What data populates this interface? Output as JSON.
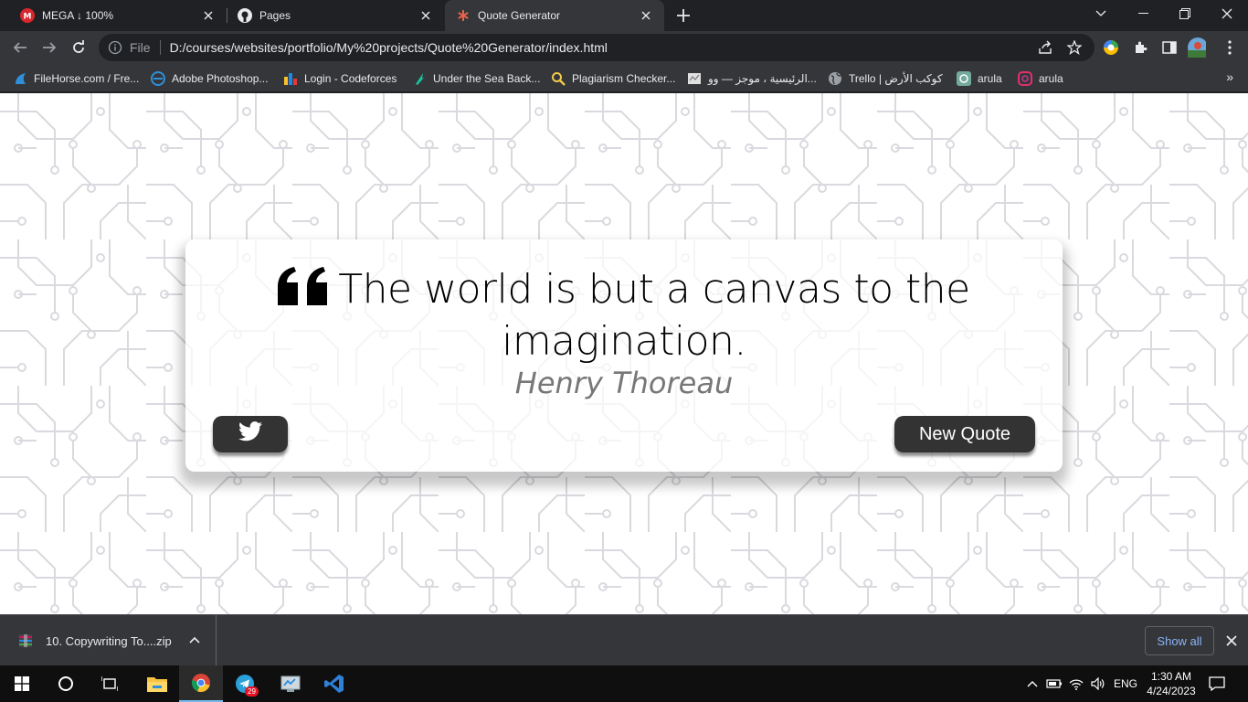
{
  "browser": {
    "tabs": [
      {
        "title": "MEGA ↓ 100%",
        "icon": "mega-icon"
      },
      {
        "title": "Pages",
        "icon": "github-icon"
      },
      {
        "title": "Quote Generator",
        "icon": "asterisk-icon",
        "active": true
      }
    ],
    "address": {
      "scheme_label": "File",
      "url": "D:/courses/websites/portfolio/My%20projects/Quote%20Generator/index.html"
    },
    "bookmarks": [
      {
        "label": "FileHorse.com / Fre...",
        "icon": "filehorse-icon"
      },
      {
        "label": "Adobe Photoshop...",
        "icon": "adobe-icon"
      },
      {
        "label": "Login - Codeforces",
        "icon": "codeforces-icon"
      },
      {
        "label": "Under the Sea Back...",
        "icon": "sea-icon"
      },
      {
        "label": "Plagiarism Checker...",
        "icon": "magnifier-icon"
      },
      {
        "label": "الرئيسية ، موجز — وو...",
        "icon": "page-icon"
      },
      {
        "label": "Trello | كوكب الأرض",
        "icon": "globe-icon"
      },
      {
        "label": "arula",
        "icon": "openai-icon"
      },
      {
        "label": "arula",
        "icon": "instagram-icon"
      }
    ]
  },
  "page": {
    "quote": "The world is but a canvas to the imagination.",
    "author": "Henry Thoreau",
    "new_quote_label": "New Quote"
  },
  "downloads": {
    "file_name": "10. Copywriting To....zip",
    "show_all_label": "Show all"
  },
  "taskbar": {
    "telegram_badge": "29",
    "language": "ENG",
    "time": "1:30 AM",
    "date": "4/24/2023"
  },
  "colors": {
    "tab_strip": "#202124",
    "toolbar": "#35363a",
    "button_bg": "#333333",
    "circuit_line": "#d9d9df",
    "taskbar": "#0f0f10"
  }
}
